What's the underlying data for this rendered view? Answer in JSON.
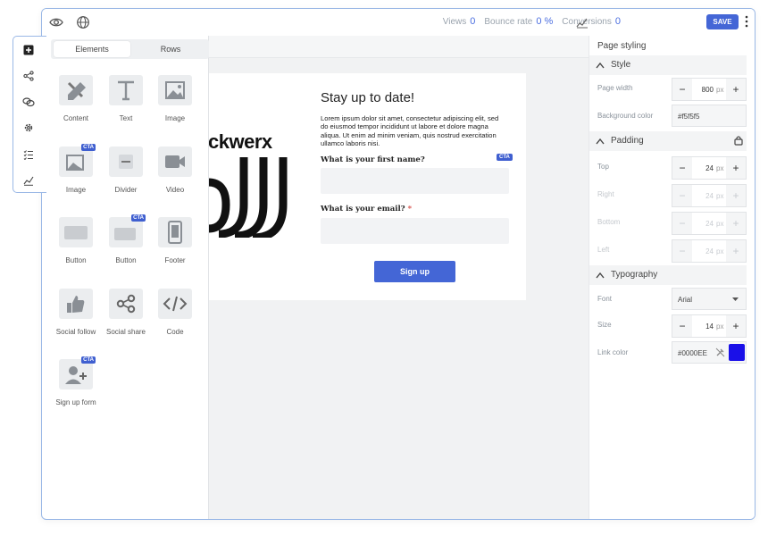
{
  "topbar": {
    "stats": [
      {
        "label": "Views",
        "value": "0"
      },
      {
        "label": "Bounce rate",
        "value": "0 %"
      },
      {
        "label": "Conversions",
        "value": "0"
      }
    ],
    "save_label": "SAVE"
  },
  "left_panel": {
    "tabs": [
      "Elements",
      "Rows"
    ],
    "tiles": [
      {
        "label": "Content",
        "icon": "content-icon"
      },
      {
        "label": "Text",
        "icon": "text-icon"
      },
      {
        "label": "Image",
        "icon": "image-icon"
      },
      {
        "label": "Image",
        "icon": "image-cta-icon",
        "badge": "CTA"
      },
      {
        "label": "Divider",
        "icon": "divider-icon"
      },
      {
        "label": "Video",
        "icon": "video-icon"
      },
      {
        "label": "Button",
        "icon": "button-icon"
      },
      {
        "label": "Button",
        "icon": "button-cta-icon",
        "badge": "CTA"
      },
      {
        "label": "Footer",
        "icon": "footer-icon"
      },
      {
        "label": "Social follow",
        "icon": "thumbs-up-icon"
      },
      {
        "label": "Social share",
        "icon": "share-icon"
      },
      {
        "label": "Code",
        "icon": "code-icon"
      },
      {
        "label": "Sign up form",
        "icon": "signup-form-icon",
        "badge": "CTA"
      }
    ]
  },
  "email": {
    "logo_text": "ckwerx",
    "heading": "Stay up to date!",
    "body": "Lorem ipsum dolor sit amet, consectetur adipiscing elit, sed do eiusmod tempor incididunt ut labore et dolore magna aliqua. Ut enim ad minim veniam, quis nostrud exercitation ullamco laboris nisi.",
    "field1_label": "What is your first name?",
    "field1_badge": "CTA",
    "field2_label": "What is your email?",
    "required_mark": "*",
    "submit_label": "Sign up"
  },
  "right_panel": {
    "title": "Page styling",
    "style_section": "Style",
    "page_width_label": "Page width",
    "page_width_value": "800",
    "unit": "px",
    "background_label": "Background color",
    "background_value": "#f5f5f5",
    "padding_section": "Padding",
    "padding": [
      {
        "label": "Top",
        "value": "24"
      },
      {
        "label": "Right",
        "value": "24"
      },
      {
        "label": "Bottom",
        "value": "24"
      },
      {
        "label": "Left",
        "value": "24"
      }
    ],
    "typography_section": "Typography",
    "font_label": "Font",
    "font_value": "Arial",
    "size_label": "Size",
    "size_value": "14",
    "link_color_label": "Link color",
    "link_color_value": "#0000EE"
  },
  "colors": {
    "accent": "#4466d6",
    "cta_badge": "#3f5fd0",
    "link_swatch": "#1a10e8",
    "required": "#d9534f"
  }
}
